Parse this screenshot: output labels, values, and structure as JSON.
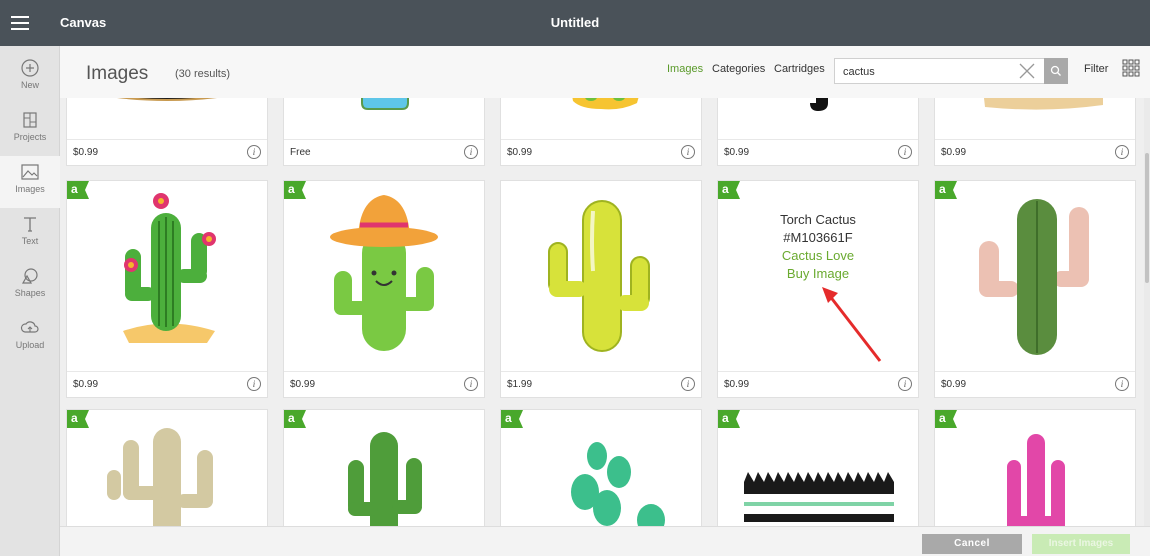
{
  "app": {
    "title": "Canvas",
    "document_title": "Untitled"
  },
  "sidebar": {
    "items": [
      {
        "label": "New",
        "icon": "plus-circle-icon"
      },
      {
        "label": "Projects",
        "icon": "projects-icon"
      },
      {
        "label": "Images",
        "icon": "image-icon",
        "active": true
      },
      {
        "label": "Text",
        "icon": "text-icon"
      },
      {
        "label": "Shapes",
        "icon": "shapes-icon"
      },
      {
        "label": "Upload",
        "icon": "upload-icon"
      }
    ]
  },
  "header": {
    "title": "Images",
    "results": "(30 results)",
    "nav": [
      {
        "label": "Images",
        "active": true
      },
      {
        "label": "Categories"
      },
      {
        "label": "Cartridges"
      }
    ],
    "search_value": "cactus",
    "filter_label": "Filter"
  },
  "grid": {
    "row1": [
      {
        "price": "$0.99"
      },
      {
        "price": "Free"
      },
      {
        "price": "$0.99"
      },
      {
        "price": "$0.99"
      },
      {
        "price": "$0.99"
      }
    ],
    "row2": [
      {
        "price": "$0.99"
      },
      {
        "price": "$0.99"
      },
      {
        "price": "$1.99"
      },
      {
        "price": "$0.99"
      },
      {
        "price": "$0.99"
      }
    ],
    "hover": {
      "name": "Torch Cactus",
      "id": "#M103661F",
      "cartridge": "Cactus Love",
      "buy": "Buy Image"
    },
    "badge_letter": "a"
  },
  "info_glyph": "i",
  "footer": {
    "cancel": "Cancel",
    "insert": "Insert Images"
  },
  "colors": {
    "topbar": "#4a5259",
    "accent_green": "#6aaa2f",
    "badge_green": "#49a82b",
    "arrow": "#e52b2b"
  }
}
